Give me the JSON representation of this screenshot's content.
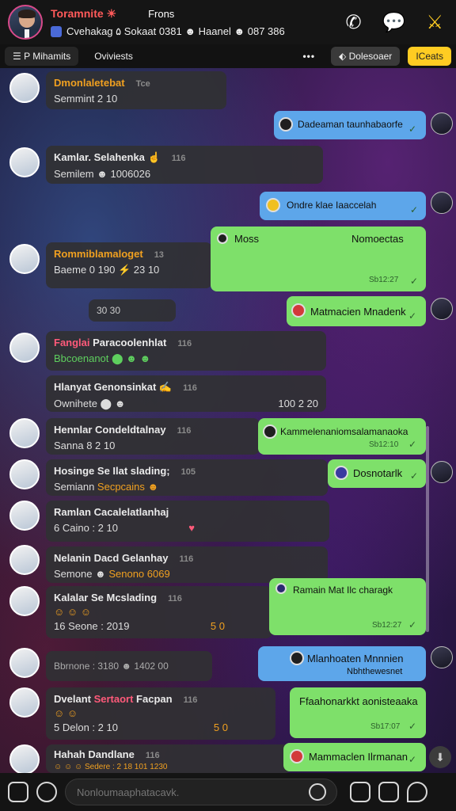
{
  "header": {
    "name": "Toramnite ☀",
    "subtitle": "Frons",
    "stats": "Cvehakag ۵ Sokaat 0381 ☻ Haanel ☻ 087 386",
    "icons": [
      "phone-icon",
      "chat-bubble-icon",
      "swords-icon"
    ]
  },
  "filters": {
    "menu_label": "☰ P Mihamits",
    "tab2": "Oviviests",
    "more": "•••",
    "chip1": "⬖ Dolesoaer",
    "chip2": "ICeats"
  },
  "messages": [
    {
      "line1": "Dmonlaletebat",
      "meta": "Tce",
      "line2": "Semmint 2 10"
    },
    {
      "line1": "Kamlar. Selahenka ☝",
      "meta": "116",
      "line2": "Semilem ☻ 1006026"
    },
    {
      "line1": "Rommiblamaloget",
      "meta": "13",
      "line2": "Baeme 0 190 ⚡ 23 10"
    },
    {
      "line1": "30 30"
    },
    {
      "line1a": "Fanglai",
      "line1b": " Paracoolenhlat",
      "meta": "116",
      "line2": "Bbcoenanot ⬤ ☻ ☻"
    },
    {
      "line1": "Hlanyat Genonsinkat ✍",
      "meta": "116",
      "line2": "Ownihete ⬤ ☻",
      "line2r": "100 2 20"
    },
    {
      "line1": "Hennlar Condeldtalnay",
      "meta": "116",
      "line2": "Sanna 8 2 10"
    },
    {
      "line1": "Hosinge Se Ilat slading;",
      "meta": "105",
      "line2a": "Semiann ",
      "line2b": "Secpcains ☻"
    },
    {
      "line1": "Ramlan Cacalelatlanhaj",
      "line2": "6 Caino : 2 10",
      "line2r": "♥"
    },
    {
      "line1": "Nelanin Dacd Gelanhay",
      "meta": "116",
      "line2a": "Semone ☻ ",
      "line2b": "Senono 6069"
    },
    {
      "line1": "Kalalar Se Mcslading",
      "meta": "116",
      "line2": "☺ ☺ ☺",
      "line3": "16 Seone : 2019",
      "line3r": "5 0"
    },
    {
      "line1": "Bbrnone : 3180 ☻ 1402 00"
    },
    {
      "line1a": "Dvelant ",
      "line1b": "Sertaort",
      "line1c": " Facpan",
      "meta": "116",
      "line2": "☺ ☺",
      "line3": "5 Delon : 2 10",
      "line3r": "5 0"
    },
    {
      "line1": "Hahah Dandlane",
      "meta": "116",
      "line2": "☺ ☺ ☺ Sedere : 2 18 101 1230"
    }
  ],
  "outgoing": [
    {
      "text": "Dadeaman taunhabaorfe",
      "color": "blue"
    },
    {
      "text": "Ondre klae Iaaccelah",
      "color": "blue"
    },
    {
      "text": "Moss",
      "text2": "Nomoectas",
      "time": "Sb12:27",
      "color": "green"
    },
    {
      "text": "Matmacien Mnadenk",
      "color": "green"
    },
    {
      "text": "Kammelenaniomsalamanaoka",
      "time": "Sb12:10",
      "color": "green"
    },
    {
      "text": "Dosnotarlk",
      "color": "green"
    },
    {
      "text": "Ramain Mat Ilc charagk",
      "time": "Sb12:27",
      "color": "green"
    },
    {
      "text": "Mlanhoaten Mnnnien",
      "text2": "Nbhthewesnet",
      "color": "blue"
    },
    {
      "text": "Ffaahonarkkt aonisteaaka",
      "time": "Sb17:07",
      "color": "green"
    },
    {
      "text": "Mammaclen Ilrmanan",
      "color": "green"
    }
  ],
  "composer": {
    "placeholder": "Nonloumaaphatacavk."
  }
}
